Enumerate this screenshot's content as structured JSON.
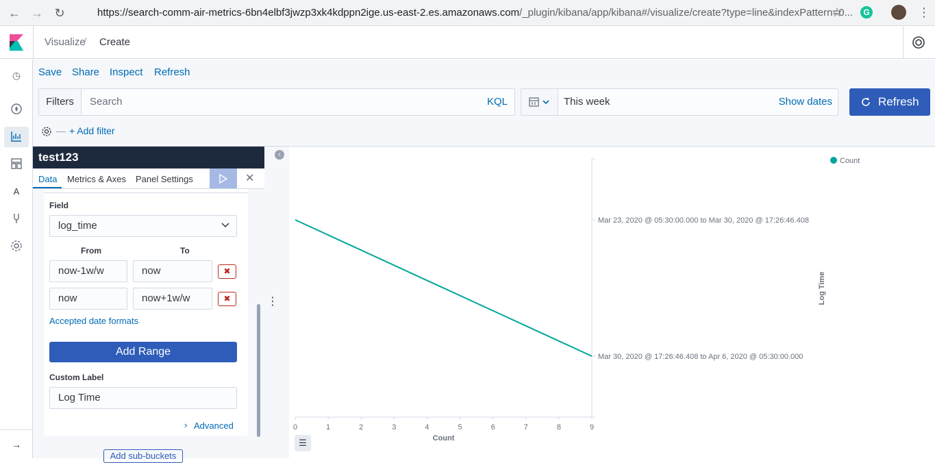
{
  "browser": {
    "url_host": "https://search-comm-air-metrics-6bn4elbf3jwzp3xk4kdppn2ige.us-east-2.es.amazonaws.com",
    "url_path": "/_plugin/kibana/app/kibana#/visualize/create?type=line&indexPattern=0...",
    "grammarly_letter": "G"
  },
  "header": {
    "breadcrumb_visualize": "Visualize",
    "breadcrumb_sep": "/",
    "breadcrumb_create": "Create"
  },
  "top_nav": {
    "save": "Save",
    "share": "Share",
    "inspect": "Inspect",
    "refresh": "Refresh"
  },
  "query_bar": {
    "filters_label": "Filters",
    "search_placeholder": "Search",
    "kql": "KQL",
    "date_range": "This week",
    "show_dates": "Show dates",
    "refresh_button": "Refresh",
    "add_filter": "+ Add filter",
    "filter_dash": "—"
  },
  "left_nav": {
    "items": [
      "clock-icon",
      "compass-icon",
      "visualize-icon",
      "dashboard-icon",
      "canvas-icon",
      "devtools-icon",
      "gear-icon"
    ],
    "canvas_letter": "A"
  },
  "editor": {
    "title": "test123",
    "tabs": [
      "Data",
      "Metrics & Axes",
      "Panel Settings"
    ],
    "field_label": "Field",
    "field_value": "log_time",
    "from_label": "From",
    "to_label": "To",
    "ranges": [
      {
        "from": "now-1w/w",
        "to": "now"
      },
      {
        "from": "now",
        "to": "now+1w/w"
      }
    ],
    "accepted_formats": "Accepted date formats",
    "add_range": "Add Range",
    "custom_label": "Custom Label",
    "custom_label_value": "Log Time",
    "advanced": "Advanced",
    "add_sub_buckets": "Add sub-buckets"
  },
  "chart_data": {
    "type": "line",
    "series": [
      {
        "name": "Count",
        "points": [
          {
            "y_index": 0,
            "x": 0
          },
          {
            "y_index": 1,
            "x": 9
          }
        ]
      }
    ],
    "y_categories": [
      "Mar 23, 2020 @ 05:30:00.000 to Mar 30, 2020 @ 17:26:46.408",
      "Mar 30, 2020 @ 17:26:46.408 to Apr 6, 2020 @ 05:30:00.000"
    ],
    "x_ticks": [
      0,
      1,
      2,
      3,
      4,
      5,
      6,
      7,
      8,
      9
    ],
    "xlabel": "Count",
    "ylabel": "Log Time",
    "xlim": [
      0,
      9
    ],
    "legend": "top-right",
    "line_color": "#00a69b"
  }
}
